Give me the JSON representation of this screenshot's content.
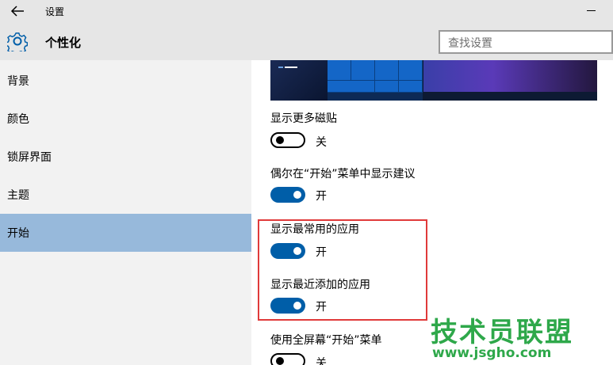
{
  "window": {
    "title": "设置"
  },
  "header": {
    "section_title": "个性化",
    "search_placeholder": "查找设置"
  },
  "sidebar": {
    "items": [
      {
        "label": "背景",
        "active": false
      },
      {
        "label": "颜色",
        "active": false
      },
      {
        "label": "锁屏界面",
        "active": false
      },
      {
        "label": "主题",
        "active": false
      },
      {
        "label": "开始",
        "active": true
      }
    ]
  },
  "settings": [
    {
      "label": "显示更多磁贴",
      "state": "关",
      "on": false
    },
    {
      "label": "偶尔在“开始”菜单中显示建议",
      "state": "开",
      "on": true
    },
    {
      "label": "显示最常用的应用",
      "state": "开",
      "on": true
    },
    {
      "label": "显示最近添加的应用",
      "state": "开",
      "on": true
    },
    {
      "label": "使用全屏幕“开始”菜单",
      "state": "关",
      "on": false
    }
  ],
  "watermark": {
    "line1": "技术员联盟",
    "line2": "www.jsgho.com"
  },
  "colors": {
    "accent": "#005ea8",
    "highlight_border": "#e03a3a",
    "active_nav": "#97b9db",
    "watermark": "#2ea84a"
  }
}
